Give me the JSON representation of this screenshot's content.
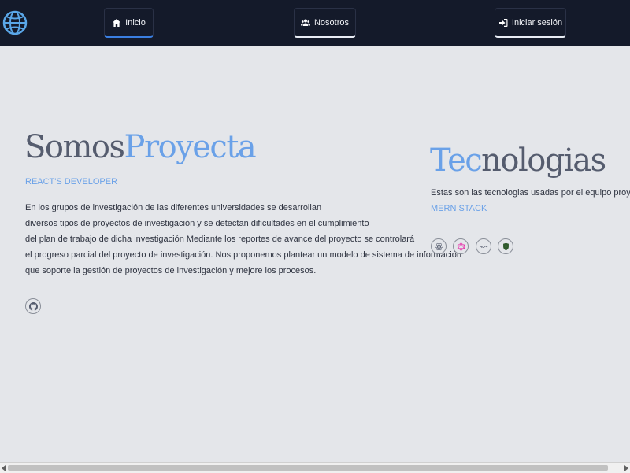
{
  "nav": {
    "items": [
      {
        "label": "Inicio",
        "icon": "home-icon",
        "active": true
      },
      {
        "label": "Nosotros",
        "icon": "users-icon",
        "active": false
      },
      {
        "label": "Iniciar sesión",
        "icon": "sign-in-icon",
        "active": false
      }
    ]
  },
  "hero": {
    "title_part1": "Somos",
    "title_part2": "Proyecta",
    "subtitle": "REACT'S DEVELOPER",
    "paragraph_lines": [
      "En los grupos de investigación de las diferentes universidades se desarrollan",
      "diversos tipos de proyectos de investigación y se detectan dificultades en el cumplimiento",
      "del plan de trabajo de dicha investigación Mediante los reportes de avance del proyecto se controlará",
      "el progreso parcial del proyecto de investigación. Nos proponemos plantear un modelo de sistema de información",
      "que soporte la gestión de proyectos de investigación y mejore los procesos."
    ],
    "social_icon": "github-icon"
  },
  "tech": {
    "title_part1": "Tec",
    "title_part2": "nologias",
    "description": "Estas son las tecnologias usadas por el equipo proyecta",
    "stack_label": "MERN STACK",
    "icons": [
      "react-icon",
      "graphql-icon",
      "express-icon",
      "mongodb-icon"
    ]
  },
  "colors": {
    "navbar_bg": "#141a2a",
    "page_bg": "#e4e6ea",
    "accent": "#6aa1e8",
    "text_dark": "#555c6e"
  }
}
